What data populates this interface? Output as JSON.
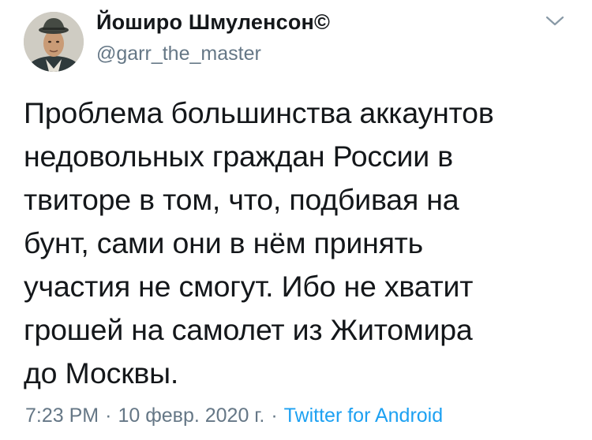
{
  "tweet": {
    "author": {
      "display_name": "Йоширо Шмуленсон©",
      "handle": "@garr_the_master",
      "avatar_icon": "user-avatar"
    },
    "menu_icon": "chevron-down-icon",
    "text": "Проблема большинства аккаунтов\nнедовольных граждан России в\nтвиторе в том, что, подбивая на\nбунт, сами они в нём принять\nучастия не смогут. Ибо не хватит\nгрошей на самолет из Житомира\nдо Москвы.",
    "time": "7:23 PM",
    "separator": "·",
    "date": "10 февр. 2020 г.",
    "source": "Twitter for Android"
  },
  "colors": {
    "text_primary": "#14171a",
    "text_secondary": "#657786",
    "link": "#1da1f2",
    "background": "#ffffff"
  }
}
